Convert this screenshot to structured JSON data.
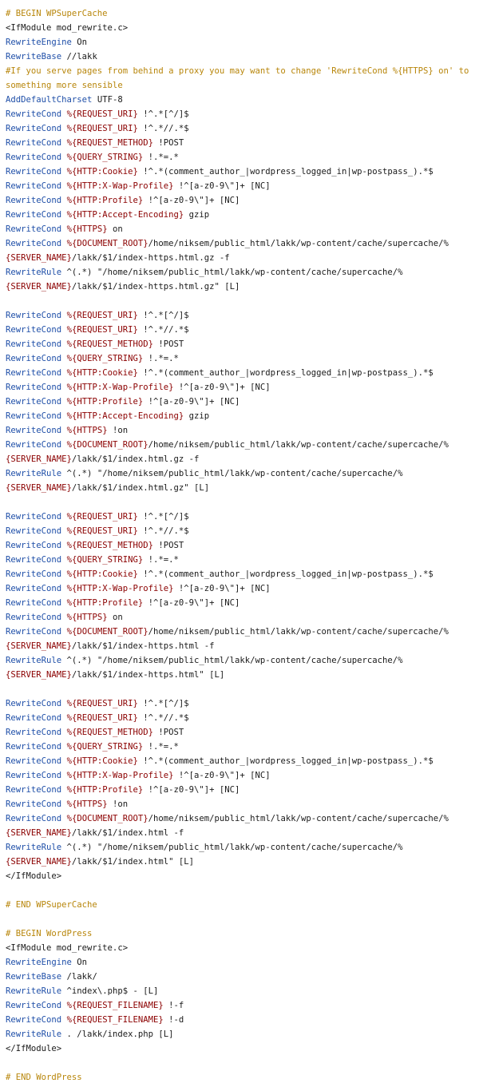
{
  "colors": {
    "comment": "#b8860b",
    "keyword": "#1f4fa8",
    "variable": "#8b0000",
    "text": "#1a1a1a",
    "background": "#ffffff"
  },
  "lines": [
    [
      [
        "comment",
        "# BEGIN WPSuperCache"
      ]
    ],
    [
      [
        "tag",
        "<IfModule mod_rewrite.c>"
      ]
    ],
    [
      [
        "kw",
        "RewriteEngine"
      ],
      [
        "plain",
        " On"
      ]
    ],
    [
      [
        "kw",
        "RewriteBase"
      ],
      [
        "plain",
        " //lakk"
      ]
    ],
    [
      [
        "comment",
        "#If you serve pages from behind a proxy you may want to change 'RewriteCond %{HTTPS} on' to"
      ]
    ],
    [
      [
        "comment",
        "something more sensible"
      ]
    ],
    [
      [
        "kw",
        "AddDefaultCharset"
      ],
      [
        "plain",
        " UTF-8"
      ]
    ],
    [
      [
        "kw",
        "RewriteCond"
      ],
      [
        "plain",
        " "
      ],
      [
        "var",
        "%{REQUEST_URI}"
      ],
      [
        "plain",
        " !^.*[^/]$"
      ]
    ],
    [
      [
        "kw",
        "RewriteCond"
      ],
      [
        "plain",
        " "
      ],
      [
        "var",
        "%{REQUEST_URI}"
      ],
      [
        "plain",
        " !^.*//.*$"
      ]
    ],
    [
      [
        "kw",
        "RewriteCond"
      ],
      [
        "plain",
        " "
      ],
      [
        "var",
        "%{REQUEST_METHOD}"
      ],
      [
        "plain",
        " !POST"
      ]
    ],
    [
      [
        "kw",
        "RewriteCond"
      ],
      [
        "plain",
        " "
      ],
      [
        "var",
        "%{QUERY_STRING}"
      ],
      [
        "plain",
        " !.*=.*"
      ]
    ],
    [
      [
        "kw",
        "RewriteCond"
      ],
      [
        "plain",
        " "
      ],
      [
        "var",
        "%{HTTP:Cookie}"
      ],
      [
        "plain",
        " !^.*(comment_author_|wordpress_logged_in|wp-postpass_).*$"
      ]
    ],
    [
      [
        "kw",
        "RewriteCond"
      ],
      [
        "plain",
        " "
      ],
      [
        "var",
        "%{HTTP:X-Wap-Profile}"
      ],
      [
        "plain",
        " !^[a-z0-9\\\"]+ [NC]"
      ]
    ],
    [
      [
        "kw",
        "RewriteCond"
      ],
      [
        "plain",
        " "
      ],
      [
        "var",
        "%{HTTP:Profile}"
      ],
      [
        "plain",
        " !^[a-z0-9\\\"]+ [NC]"
      ]
    ],
    [
      [
        "kw",
        "RewriteCond"
      ],
      [
        "plain",
        " "
      ],
      [
        "var",
        "%{HTTP:Accept-Encoding}"
      ],
      [
        "plain",
        " gzip"
      ]
    ],
    [
      [
        "kw",
        "RewriteCond"
      ],
      [
        "plain",
        " "
      ],
      [
        "var",
        "%{HTTPS}"
      ],
      [
        "plain",
        " on"
      ]
    ],
    [
      [
        "kw",
        "RewriteCond"
      ],
      [
        "plain",
        " "
      ],
      [
        "var",
        "%{DOCUMENT_ROOT}"
      ],
      [
        "plain",
        "/home/niksem/public_html/lakk/wp-content/cache/supercache/%"
      ]
    ],
    [
      [
        "var",
        "{SERVER_NAME}"
      ],
      [
        "plain",
        "/lakk/$1/index-https.html.gz -f"
      ]
    ],
    [
      [
        "kw",
        "RewriteRule"
      ],
      [
        "plain",
        " ^(.*) \"/home/niksem/public_html/lakk/wp-content/cache/supercache/%"
      ]
    ],
    [
      [
        "var",
        "{SERVER_NAME}"
      ],
      [
        "plain",
        "/lakk/$1/index-https.html.gz\" [L]"
      ]
    ],
    [],
    [
      [
        "kw",
        "RewriteCond"
      ],
      [
        "plain",
        " "
      ],
      [
        "var",
        "%{REQUEST_URI}"
      ],
      [
        "plain",
        " !^.*[^/]$"
      ]
    ],
    [
      [
        "kw",
        "RewriteCond"
      ],
      [
        "plain",
        " "
      ],
      [
        "var",
        "%{REQUEST_URI}"
      ],
      [
        "plain",
        " !^.*//.*$"
      ]
    ],
    [
      [
        "kw",
        "RewriteCond"
      ],
      [
        "plain",
        " "
      ],
      [
        "var",
        "%{REQUEST_METHOD}"
      ],
      [
        "plain",
        " !POST"
      ]
    ],
    [
      [
        "kw",
        "RewriteCond"
      ],
      [
        "plain",
        " "
      ],
      [
        "var",
        "%{QUERY_STRING}"
      ],
      [
        "plain",
        " !.*=.*"
      ]
    ],
    [
      [
        "kw",
        "RewriteCond"
      ],
      [
        "plain",
        " "
      ],
      [
        "var",
        "%{HTTP:Cookie}"
      ],
      [
        "plain",
        " !^.*(comment_author_|wordpress_logged_in|wp-postpass_).*$"
      ]
    ],
    [
      [
        "kw",
        "RewriteCond"
      ],
      [
        "plain",
        " "
      ],
      [
        "var",
        "%{HTTP:X-Wap-Profile}"
      ],
      [
        "plain",
        " !^[a-z0-9\\\"]+ [NC]"
      ]
    ],
    [
      [
        "kw",
        "RewriteCond"
      ],
      [
        "plain",
        " "
      ],
      [
        "var",
        "%{HTTP:Profile}"
      ],
      [
        "plain",
        " !^[a-z0-9\\\"]+ [NC]"
      ]
    ],
    [
      [
        "kw",
        "RewriteCond"
      ],
      [
        "plain",
        " "
      ],
      [
        "var",
        "%{HTTP:Accept-Encoding}"
      ],
      [
        "plain",
        " gzip"
      ]
    ],
    [
      [
        "kw",
        "RewriteCond"
      ],
      [
        "plain",
        " "
      ],
      [
        "var",
        "%{HTTPS}"
      ],
      [
        "plain",
        " !on"
      ]
    ],
    [
      [
        "kw",
        "RewriteCond"
      ],
      [
        "plain",
        " "
      ],
      [
        "var",
        "%{DOCUMENT_ROOT}"
      ],
      [
        "plain",
        "/home/niksem/public_html/lakk/wp-content/cache/supercache/%"
      ]
    ],
    [
      [
        "var",
        "{SERVER_NAME}"
      ],
      [
        "plain",
        "/lakk/$1/index.html.gz -f"
      ]
    ],
    [
      [
        "kw",
        "RewriteRule"
      ],
      [
        "plain",
        " ^(.*) \"/home/niksem/public_html/lakk/wp-content/cache/supercache/%"
      ]
    ],
    [
      [
        "var",
        "{SERVER_NAME}"
      ],
      [
        "plain",
        "/lakk/$1/index.html.gz\" [L]"
      ]
    ],
    [],
    [
      [
        "kw",
        "RewriteCond"
      ],
      [
        "plain",
        " "
      ],
      [
        "var",
        "%{REQUEST_URI}"
      ],
      [
        "plain",
        " !^.*[^/]$"
      ]
    ],
    [
      [
        "kw",
        "RewriteCond"
      ],
      [
        "plain",
        " "
      ],
      [
        "var",
        "%{REQUEST_URI}"
      ],
      [
        "plain",
        " !^.*//.*$"
      ]
    ],
    [
      [
        "kw",
        "RewriteCond"
      ],
      [
        "plain",
        " "
      ],
      [
        "var",
        "%{REQUEST_METHOD}"
      ],
      [
        "plain",
        " !POST"
      ]
    ],
    [
      [
        "kw",
        "RewriteCond"
      ],
      [
        "plain",
        " "
      ],
      [
        "var",
        "%{QUERY_STRING}"
      ],
      [
        "plain",
        " !.*=.*"
      ]
    ],
    [
      [
        "kw",
        "RewriteCond"
      ],
      [
        "plain",
        " "
      ],
      [
        "var",
        "%{HTTP:Cookie}"
      ],
      [
        "plain",
        " !^.*(comment_author_|wordpress_logged_in|wp-postpass_).*$"
      ]
    ],
    [
      [
        "kw",
        "RewriteCond"
      ],
      [
        "plain",
        " "
      ],
      [
        "var",
        "%{HTTP:X-Wap-Profile}"
      ],
      [
        "plain",
        " !^[a-z0-9\\\"]+ [NC]"
      ]
    ],
    [
      [
        "kw",
        "RewriteCond"
      ],
      [
        "plain",
        " "
      ],
      [
        "var",
        "%{HTTP:Profile}"
      ],
      [
        "plain",
        " !^[a-z0-9\\\"]+ [NC]"
      ]
    ],
    [
      [
        "kw",
        "RewriteCond"
      ],
      [
        "plain",
        " "
      ],
      [
        "var",
        "%{HTTPS}"
      ],
      [
        "plain",
        " on"
      ]
    ],
    [
      [
        "kw",
        "RewriteCond"
      ],
      [
        "plain",
        " "
      ],
      [
        "var",
        "%{DOCUMENT_ROOT}"
      ],
      [
        "plain",
        "/home/niksem/public_html/lakk/wp-content/cache/supercache/%"
      ]
    ],
    [
      [
        "var",
        "{SERVER_NAME}"
      ],
      [
        "plain",
        "/lakk/$1/index-https.html -f"
      ]
    ],
    [
      [
        "kw",
        "RewriteRule"
      ],
      [
        "plain",
        " ^(.*) \"/home/niksem/public_html/lakk/wp-content/cache/supercache/%"
      ]
    ],
    [
      [
        "var",
        "{SERVER_NAME}"
      ],
      [
        "plain",
        "/lakk/$1/index-https.html\" [L]"
      ]
    ],
    [],
    [
      [
        "kw",
        "RewriteCond"
      ],
      [
        "plain",
        " "
      ],
      [
        "var",
        "%{REQUEST_URI}"
      ],
      [
        "plain",
        " !^.*[^/]$"
      ]
    ],
    [
      [
        "kw",
        "RewriteCond"
      ],
      [
        "plain",
        " "
      ],
      [
        "var",
        "%{REQUEST_URI}"
      ],
      [
        "plain",
        " !^.*//.*$"
      ]
    ],
    [
      [
        "kw",
        "RewriteCond"
      ],
      [
        "plain",
        " "
      ],
      [
        "var",
        "%{REQUEST_METHOD}"
      ],
      [
        "plain",
        " !POST"
      ]
    ],
    [
      [
        "kw",
        "RewriteCond"
      ],
      [
        "plain",
        " "
      ],
      [
        "var",
        "%{QUERY_STRING}"
      ],
      [
        "plain",
        " !.*=.*"
      ]
    ],
    [
      [
        "kw",
        "RewriteCond"
      ],
      [
        "plain",
        " "
      ],
      [
        "var",
        "%{HTTP:Cookie}"
      ],
      [
        "plain",
        " !^.*(comment_author_|wordpress_logged_in|wp-postpass_).*$"
      ]
    ],
    [
      [
        "kw",
        "RewriteCond"
      ],
      [
        "plain",
        " "
      ],
      [
        "var",
        "%{HTTP:X-Wap-Profile}"
      ],
      [
        "plain",
        " !^[a-z0-9\\\"]+ [NC]"
      ]
    ],
    [
      [
        "kw",
        "RewriteCond"
      ],
      [
        "plain",
        " "
      ],
      [
        "var",
        "%{HTTP:Profile}"
      ],
      [
        "plain",
        " !^[a-z0-9\\\"]+ [NC]"
      ]
    ],
    [
      [
        "kw",
        "RewriteCond"
      ],
      [
        "plain",
        " "
      ],
      [
        "var",
        "%{HTTPS}"
      ],
      [
        "plain",
        " !on"
      ]
    ],
    [
      [
        "kw",
        "RewriteCond"
      ],
      [
        "plain",
        " "
      ],
      [
        "var",
        "%{DOCUMENT_ROOT}"
      ],
      [
        "plain",
        "/home/niksem/public_html/lakk/wp-content/cache/supercache/%"
      ]
    ],
    [
      [
        "var",
        "{SERVER_NAME}"
      ],
      [
        "plain",
        "/lakk/$1/index.html -f"
      ]
    ],
    [
      [
        "kw",
        "RewriteRule"
      ],
      [
        "plain",
        " ^(.*) \"/home/niksem/public_html/lakk/wp-content/cache/supercache/%"
      ]
    ],
    [
      [
        "var",
        "{SERVER_NAME}"
      ],
      [
        "plain",
        "/lakk/$1/index.html\" [L]"
      ]
    ],
    [
      [
        "tag",
        "</IfModule>"
      ]
    ],
    [],
    [
      [
        "comment",
        "# END WPSuperCache"
      ]
    ],
    [],
    [
      [
        "comment",
        "# BEGIN WordPress"
      ]
    ],
    [
      [
        "tag",
        "<IfModule mod_rewrite.c>"
      ]
    ],
    [
      [
        "kw",
        "RewriteEngine"
      ],
      [
        "plain",
        " On"
      ]
    ],
    [
      [
        "kw",
        "RewriteBase"
      ],
      [
        "plain",
        " /lakk/"
      ]
    ],
    [
      [
        "kw",
        "RewriteRule"
      ],
      [
        "plain",
        " ^index\\.php$ - [L]"
      ]
    ],
    [
      [
        "kw",
        "RewriteCond"
      ],
      [
        "plain",
        " "
      ],
      [
        "var",
        "%{REQUEST_FILENAME}"
      ],
      [
        "plain",
        " !-f"
      ]
    ],
    [
      [
        "kw",
        "RewriteCond"
      ],
      [
        "plain",
        " "
      ],
      [
        "var",
        "%{REQUEST_FILENAME}"
      ],
      [
        "plain",
        " !-d"
      ]
    ],
    [
      [
        "kw",
        "RewriteRule"
      ],
      [
        "plain",
        " . /lakk/index.php [L]"
      ]
    ],
    [
      [
        "tag",
        "</IfModule>"
      ]
    ],
    [],
    [
      [
        "comment",
        "# END WordPress"
      ]
    ]
  ]
}
